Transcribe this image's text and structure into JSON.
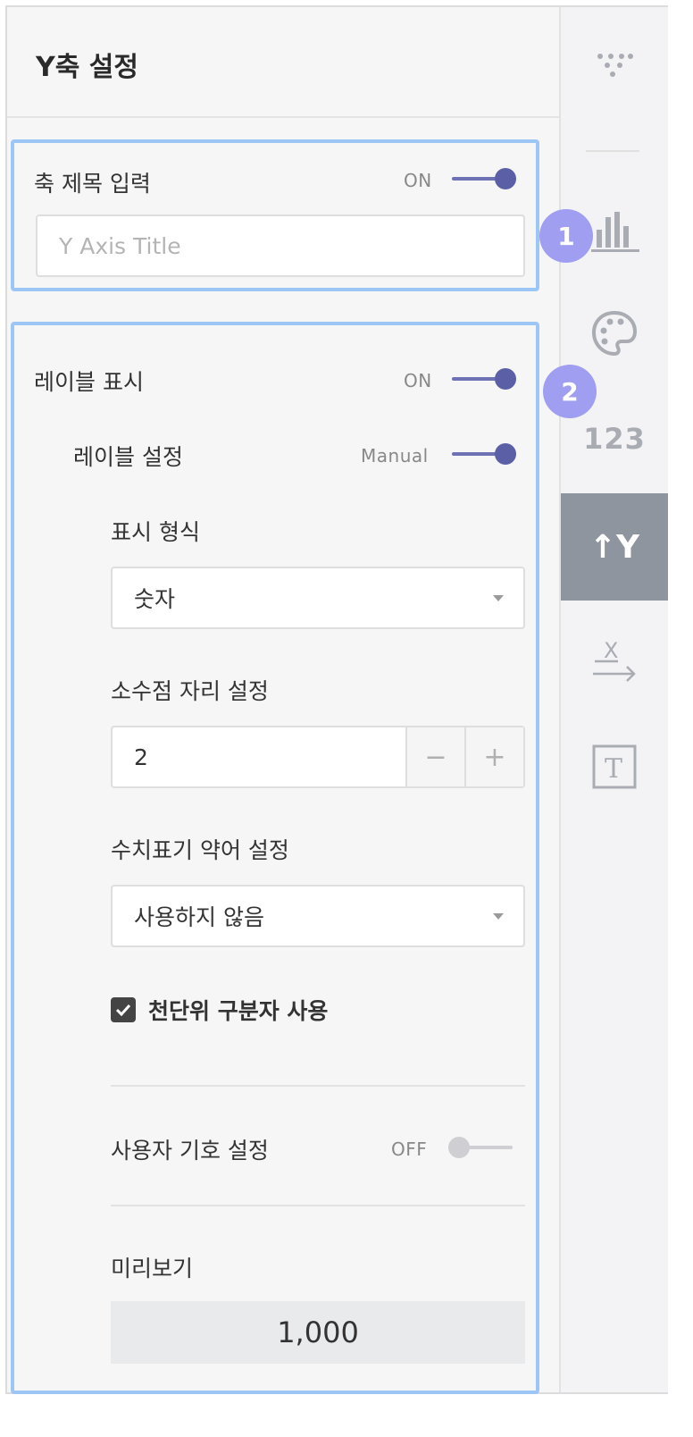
{
  "panel": {
    "title": "Y축 설정"
  },
  "axis_title": {
    "label": "축 제목 입력",
    "toggle_text": "ON",
    "placeholder": "Y Axis Title"
  },
  "labels": {
    "label": "레이블 표시",
    "toggle_text": "ON",
    "settings_label": "레이블 설정",
    "settings_toggle_text": "Manual",
    "format": {
      "label": "표시 형식",
      "value": "숫자"
    },
    "decimal": {
      "label": "소수점 자리 설정",
      "value": "2",
      "minus": "−",
      "plus": "+"
    },
    "abbreviation": {
      "label": "수치표기 약어 설정",
      "value": "사용하지 않음"
    },
    "thousand_sep": {
      "label": "천단위 구분자 사용",
      "checked": true
    },
    "custom_symbol": {
      "label": "사용자 기호 설정",
      "toggle_text": "OFF"
    },
    "preview": {
      "label": "미리보기",
      "value": "1,000"
    }
  },
  "rail": {
    "items": [
      {
        "icon": "scatter-dots-icon"
      },
      {
        "icon": "bar-chart-icon"
      },
      {
        "icon": "palette-icon"
      },
      {
        "icon": "number-format-icon",
        "text": "123"
      },
      {
        "icon": "y-axis-icon",
        "text": "↑Y",
        "active": true
      },
      {
        "icon": "x-axis-icon",
        "text": "X"
      },
      {
        "icon": "text-icon",
        "text": "T"
      }
    ]
  },
  "badges": [
    "1",
    "2"
  ],
  "colors": {
    "highlight": "#9cc6f5",
    "toggle_on": "#5b5fa6",
    "badge": "#9f9ef0",
    "active_rail": "#8f959e"
  }
}
